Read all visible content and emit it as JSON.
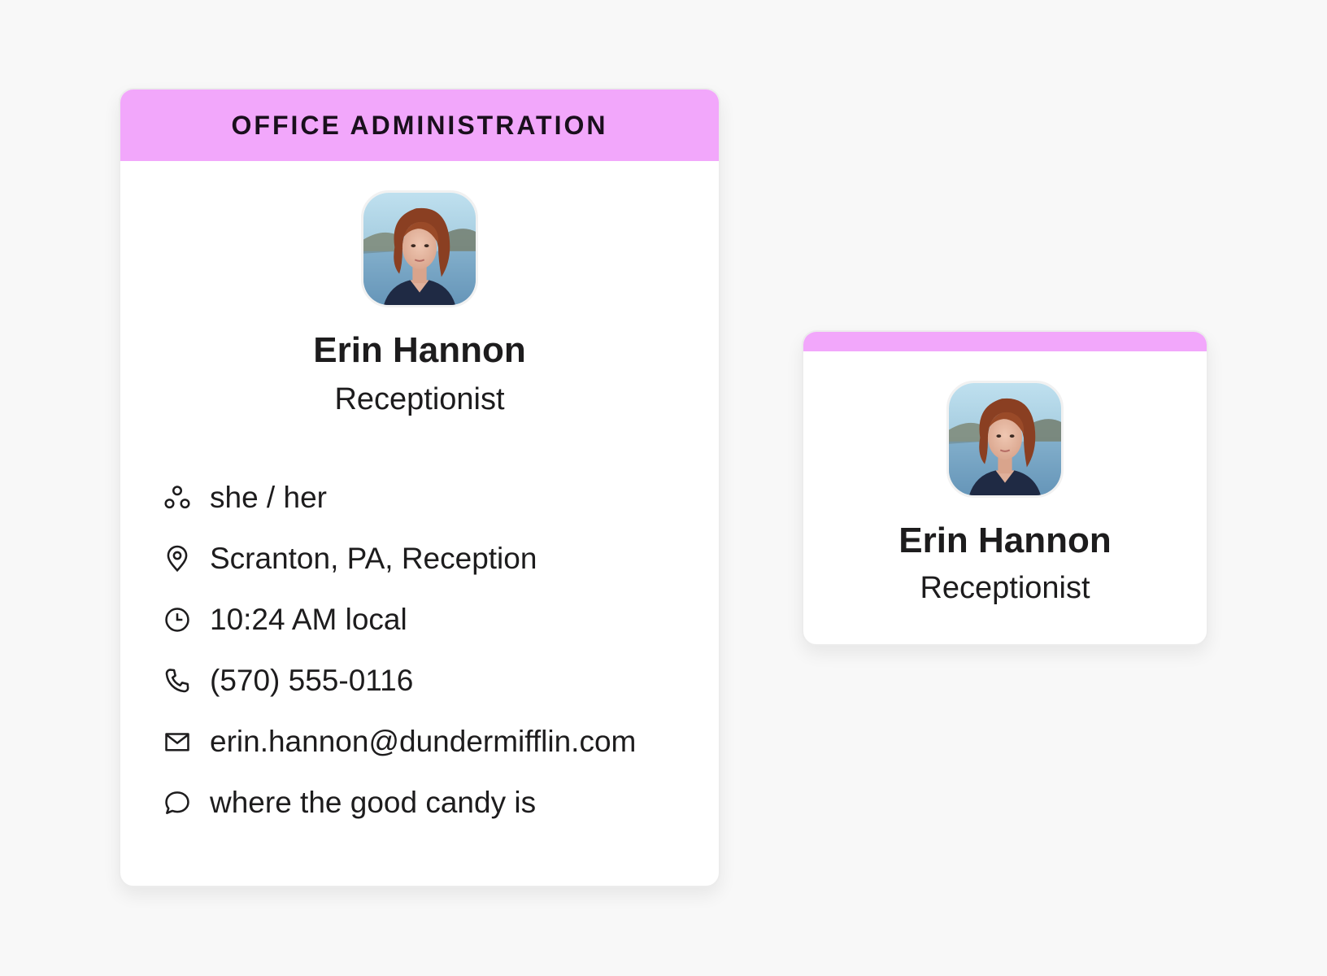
{
  "profile": {
    "department": "OFFICE ADMINISTRATION",
    "name": "Erin Hannon",
    "title": "Receptionist",
    "accent_color": "#f2a7fb",
    "details": [
      {
        "icon": "pronouns-icon",
        "text": "she / her"
      },
      {
        "icon": "location-pin-icon",
        "text": "Scranton, PA, Reception"
      },
      {
        "icon": "clock-icon",
        "text": "10:24 AM local"
      },
      {
        "icon": "phone-icon",
        "text": "(570) 555-0116"
      },
      {
        "icon": "mail-icon",
        "text": "erin.hannon@dundermifflin.com"
      },
      {
        "icon": "chat-bubble-icon",
        "text": "where the good candy is"
      }
    ]
  },
  "compact_profile": {
    "name": "Erin Hannon",
    "title": "Receptionist"
  }
}
